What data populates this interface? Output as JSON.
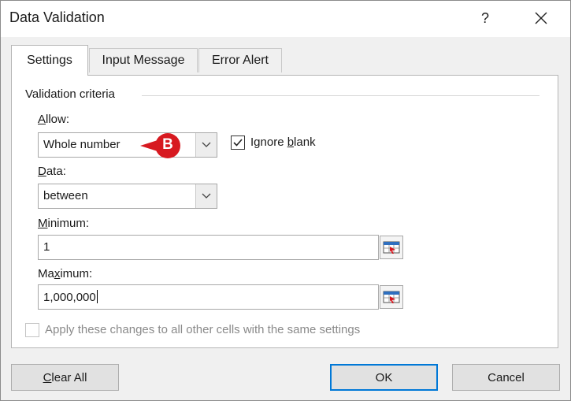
{
  "window": {
    "title": "Data Validation",
    "help_label": "?"
  },
  "tabs": [
    {
      "label": "Settings",
      "active": true
    },
    {
      "label": "Input Message",
      "active": false
    },
    {
      "label": "Error Alert",
      "active": false
    }
  ],
  "settings": {
    "group_label": "Validation criteria",
    "allow": {
      "label_u": "A",
      "label_rest": "llow:",
      "value": "Whole number"
    },
    "ignore_blank": {
      "label_pre": "Ignore ",
      "label_u": "b",
      "label_post": "lank",
      "checked": true
    },
    "data": {
      "label_u": "D",
      "label_rest": "ata:",
      "value": "between"
    },
    "minimum": {
      "label_u": "M",
      "label_rest": "inimum:",
      "value": "1"
    },
    "maximum": {
      "label_pre": "Ma",
      "label_u": "x",
      "label_post": "imum:",
      "value": "1,000,000"
    },
    "apply_all": {
      "label": "Apply these changes to all other cells with the same settings",
      "checked": false,
      "enabled": false
    }
  },
  "callout": {
    "letter": "B",
    "color": "#d71920"
  },
  "buttons": {
    "clear_u": "C",
    "clear_rest": "lear All",
    "ok": "OK",
    "cancel": "Cancel"
  },
  "colors": {
    "default_button_border": "#0078d7",
    "dialog_background": "#f0f0f0"
  }
}
